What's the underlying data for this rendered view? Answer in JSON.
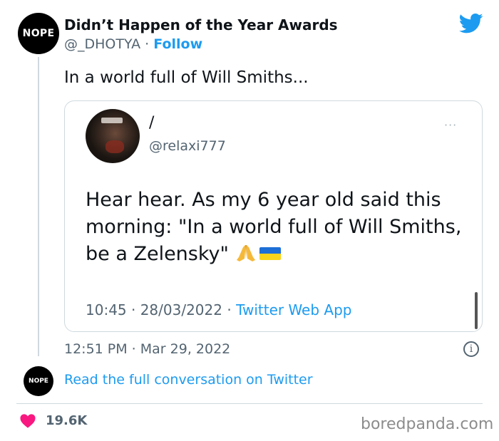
{
  "author": {
    "avatar_text": "NOPE",
    "name": "Didn’t Happen of the Year Awards",
    "handle": "@_DHOTYA",
    "separator": " · ",
    "follow_label": "Follow"
  },
  "tweet": {
    "text": "In a world full of Will Smiths...",
    "time": "12:51 PM · Mar 29, 2022"
  },
  "quoted": {
    "name": "/",
    "handle": "@relaxi777",
    "more": "···",
    "body": "Hear hear. As my 6 year old said this morning: \"In a world full of Will Smiths, be a Zelensky\" ",
    "time": "10:45 · 28/03/2022 · ",
    "app": "Twitter Web App"
  },
  "footer": {
    "avatar_text": "NOPE",
    "read_link": "Read the full conversation on Twitter",
    "likes": "19.6K",
    "watermark": "boredpanda.com"
  },
  "icons": {
    "logo": "twitter-bird-icon",
    "info": "info-icon",
    "like": "heart-icon",
    "pray": "folded-hands-emoji",
    "flag": "ukraine-flag-emoji"
  },
  "colors": {
    "accent": "#1d9bf0",
    "heart": "#f91880",
    "muted": "#536471"
  }
}
